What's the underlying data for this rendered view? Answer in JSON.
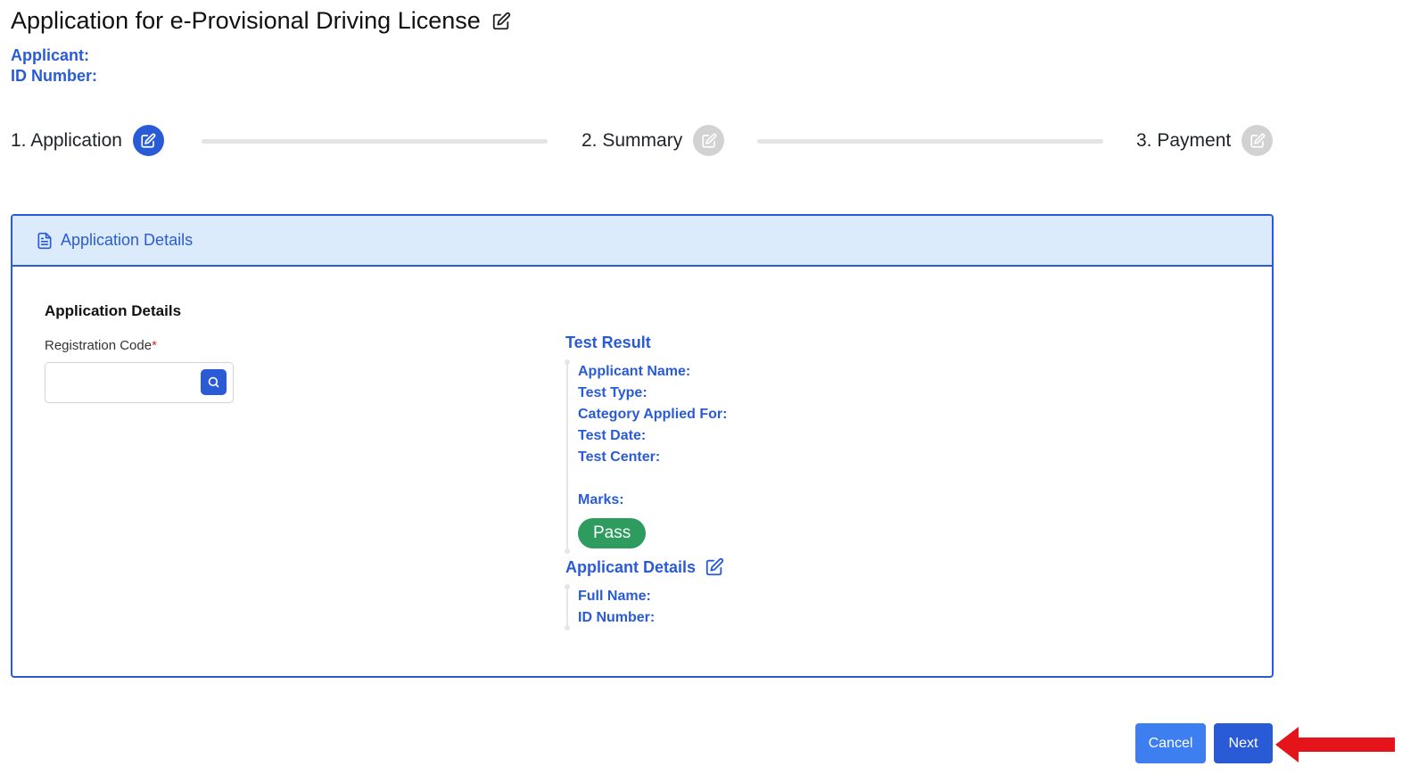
{
  "header": {
    "title": "Application for e-Provisional Driving License",
    "applicant_label": "Applicant:",
    "id_number_label": "ID Number:"
  },
  "stepper": {
    "steps": [
      {
        "label": "1. Application",
        "state": "active"
      },
      {
        "label": "2. Summary",
        "state": "inactive"
      },
      {
        "label": "3. Payment",
        "state": "inactive"
      }
    ]
  },
  "card": {
    "header_title": "Application Details",
    "left": {
      "section_label": "Application Details",
      "registration_label": "Registration Code",
      "required_mark": "*",
      "registration_value": "",
      "registration_placeholder": ""
    },
    "test_result": {
      "title": "Test Result",
      "fields": [
        "Applicant Name:",
        "Test Type:",
        "Category Applied For:",
        "Test Date:",
        "Test Center:"
      ],
      "marks_label": "Marks:",
      "status": "Pass"
    },
    "applicant_details": {
      "title": "Applicant Details",
      "fields": [
        "Full Name:",
        "ID Number:"
      ]
    }
  },
  "actions": {
    "cancel_label": "Cancel",
    "next_label": "Next"
  },
  "colors": {
    "primary": "#2a5bd7",
    "cancel": "#3d7ef0",
    "header_bg": "#dcebfb",
    "pass": "#2e9b5f",
    "inactive": "#d2d2d2",
    "arrow": "#e4141a"
  },
  "icons": {
    "title": "edit-icon",
    "step": "edit-icon",
    "card_header": "document-icon",
    "search": "search-icon",
    "applicant_details": "edit-icon",
    "annotation": "red-arrow-icon"
  }
}
